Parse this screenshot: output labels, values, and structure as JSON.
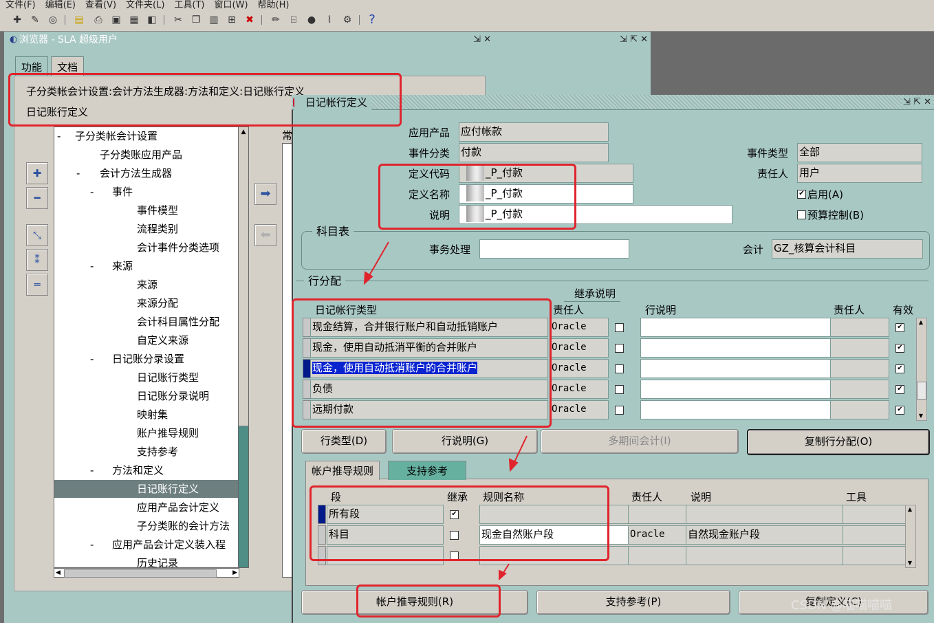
{
  "menubar": {
    "items": [
      "文件(F)",
      "编辑(E)",
      "查看(V)",
      "文件夹(L)",
      "工具(T)",
      "窗口(W)",
      "帮助(H)"
    ]
  },
  "toolbar": {
    "help_glyph": "?"
  },
  "navigator": {
    "title": "浏览器 - SLA 超级用户",
    "tabs": [
      "功能",
      "文档"
    ],
    "breadcrumb_line1": "子分类帐会计设置:会计方法生成器:方法和定义:日记账行定义",
    "breadcrumb_line2": "日记账行定义",
    "tree": [
      {
        "label": "子分类帐会计设置",
        "prefix": "-",
        "level": 0
      },
      {
        "label": "子分类账应用产品",
        "prefix": "",
        "level": 1
      },
      {
        "label": "会计方法生成器",
        "prefix": "-",
        "level": 1
      },
      {
        "label": "事件",
        "prefix": "-",
        "level": 2
      },
      {
        "label": "事件模型",
        "prefix": "",
        "level": 3
      },
      {
        "label": "流程类别",
        "prefix": "",
        "level": 3
      },
      {
        "label": "会计事件分类选项",
        "prefix": "",
        "level": 3
      },
      {
        "label": "来源",
        "prefix": "-",
        "level": 2
      },
      {
        "label": "来源",
        "prefix": "",
        "level": 3
      },
      {
        "label": "来源分配",
        "prefix": "",
        "level": 3
      },
      {
        "label": "会计科目属性分配",
        "prefix": "",
        "level": 3
      },
      {
        "label": "自定义来源",
        "prefix": "",
        "level": 3
      },
      {
        "label": "日记账分录设置",
        "prefix": "-",
        "level": 2
      },
      {
        "label": "日记账行类型",
        "prefix": "",
        "level": 3
      },
      {
        "label": "日记账分录说明",
        "prefix": "",
        "level": 3
      },
      {
        "label": "映射集",
        "prefix": "",
        "level": 3
      },
      {
        "label": "账户推导规则",
        "prefix": "",
        "level": 3
      },
      {
        "label": "支持参考",
        "prefix": "",
        "level": 3
      },
      {
        "label": "方法和定义",
        "prefix": "-",
        "level": 2
      },
      {
        "label": "日记账行定义",
        "prefix": "",
        "level": 3,
        "selected": true
      },
      {
        "label": "应用产品会计定义",
        "prefix": "",
        "level": 3
      },
      {
        "label": "子分类账的会计方法",
        "prefix": "",
        "level": 3
      },
      {
        "label": "应用产品会计定义装入程",
        "prefix": "-",
        "level": 2
      },
      {
        "label": "历史记录",
        "prefix": "",
        "level": 3
      }
    ],
    "partial_label": "常"
  },
  "dialog": {
    "title": "日记帐行定义",
    "labels": {
      "application": "应用产品",
      "event_class": "事件分类",
      "def_code": "定义代码",
      "def_name": "定义名称",
      "description": "说明",
      "event_type": "事件类型",
      "owner": "责任人",
      "enabled": "启用(A)",
      "budget": "预算控制(B)"
    },
    "values": {
      "application": "应付帐款",
      "event_class": "付款",
      "def_code": "_P_付款",
      "def_name": "_P_付款",
      "description": "_P_付款",
      "event_type": "全部",
      "owner": "用户"
    },
    "coa": {
      "frame_label": "科目表",
      "transaction_label": "事务处理",
      "transaction_value": "",
      "accounting_label": "会计",
      "accounting_value": "GZ_核算会计科目"
    },
    "line_assign": {
      "frame_label": "行分配",
      "inherit_desc_header": "继承说明",
      "col_type": "日记帐行类型",
      "col_owner": "责任人",
      "col_line_desc": "行说明",
      "col_owner2": "责任人",
      "col_valid": "有效",
      "rows": [
        {
          "type": "现金结算，合并银行账户和自动抵销账户",
          "owner": "Oracle",
          "inherit": false,
          "valid": true,
          "current": false
        },
        {
          "type": "现金，使用自动抵消平衡的合并账户",
          "owner": "Oracle",
          "inherit": false,
          "valid": true,
          "current": false
        },
        {
          "type": "现金，使用自动抵消账户的合并账户",
          "owner": "Oracle",
          "inherit": false,
          "valid": true,
          "current": true
        },
        {
          "type": "负债",
          "owner": "Oracle",
          "inherit": false,
          "valid": true,
          "current": false
        },
        {
          "type": "远期付款",
          "owner": "Oracle",
          "inherit": false,
          "valid": true,
          "current": false
        }
      ]
    },
    "buttons_row1": [
      "行类型(D)",
      "行说明(G)",
      "多期间会计(I)",
      "复制行分配(O)"
    ],
    "subtabs": [
      "帐户推导规则",
      "支持参考"
    ],
    "rules": {
      "col_segment": "段",
      "col_inherit": "继承",
      "col_rule_name": "规则名称",
      "col_owner": "责任人",
      "col_desc": "说明",
      "col_tool": "工具",
      "rows": [
        {
          "segment": "所有段",
          "inherit": true,
          "rule_name": "",
          "owner": "",
          "desc": ""
        },
        {
          "segment": "科目",
          "inherit": false,
          "rule_name": "现金自然账户段",
          "owner": "Oracle",
          "desc": "自然现金账户段"
        },
        {
          "segment": "",
          "inherit": false,
          "rule_name": "",
          "owner": "",
          "desc": ""
        }
      ]
    },
    "buttons_row2": [
      "帐户推导规则(R)",
      "支持参考(P)",
      "复制定义(C)"
    ]
  },
  "watermark": "CSDN @喵喵喵喵",
  "colors": {
    "annotation_red": "#e0242c",
    "window_teal": "#a8c8c4",
    "selection_blue": "#0a24d0"
  }
}
